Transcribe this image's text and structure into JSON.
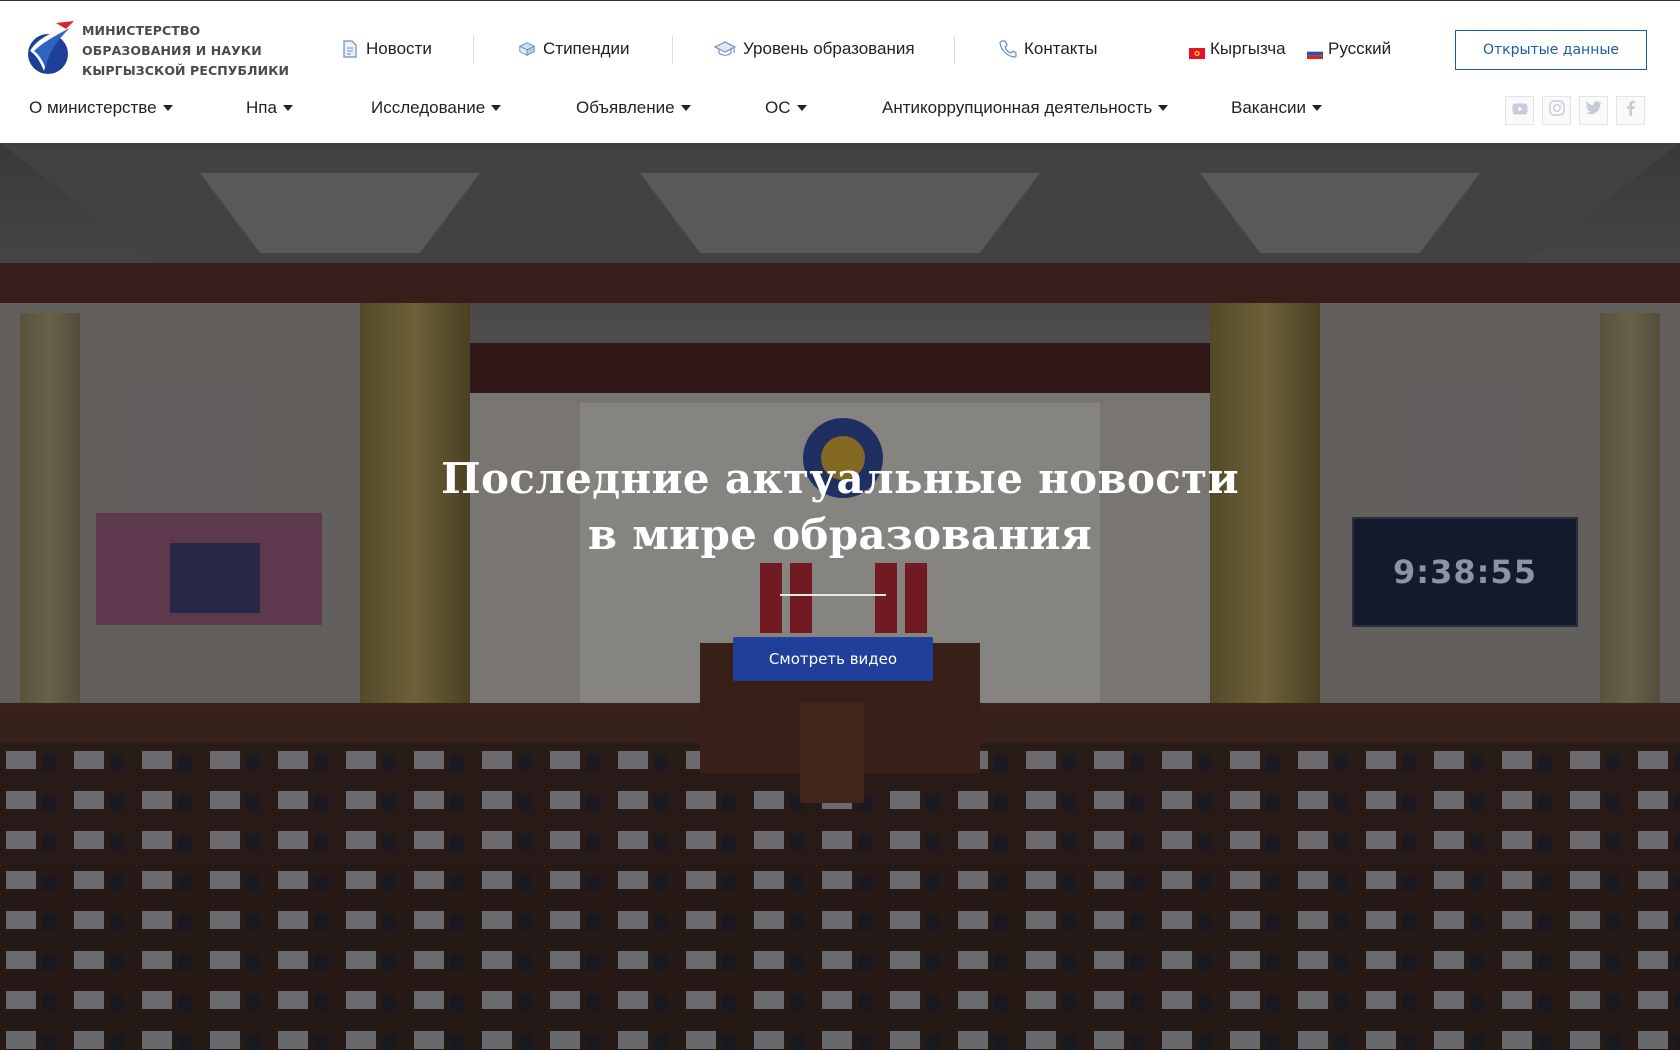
{
  "logo": {
    "line1": "МИНИСТЕРСТВО",
    "line2": "ОБРАЗОВАНИЯ И НАУКИ",
    "line3": "КЫРГЫЗСКОЙ РЕСПУБЛИКИ"
  },
  "top_links": [
    {
      "label": "Новости",
      "icon": "document-icon"
    },
    {
      "label": "Стипендии",
      "icon": "box-icon"
    },
    {
      "label": "Уровень образования",
      "icon": "graduation-cap-icon"
    },
    {
      "label": "Контакты",
      "icon": "phone-icon"
    }
  ],
  "languages": [
    {
      "label": "Кыргызча",
      "icon": "flag-kg-icon"
    },
    {
      "label": "Русский",
      "icon": "flag-ru-icon"
    }
  ],
  "open_data_label": "Открытые данные",
  "nav": [
    {
      "label": "О министерстве"
    },
    {
      "label": "Нпа"
    },
    {
      "label": "Исследование"
    },
    {
      "label": "Объявление"
    },
    {
      "label": "ОС"
    },
    {
      "label": "Антикоррупционная деятельность"
    },
    {
      "label": "Вакансии"
    }
  ],
  "socials": [
    "youtube-icon",
    "instagram-icon",
    "twitter-icon",
    "facebook-icon"
  ],
  "hero": {
    "title_line1": "Последние актуальные новости",
    "title_line2": "в мире образования",
    "button_label": "Смотреть видео",
    "clock_text": "9:38:55"
  },
  "colors": {
    "accent": "#1e5aa8",
    "hero_button": "#1f3f9a"
  }
}
